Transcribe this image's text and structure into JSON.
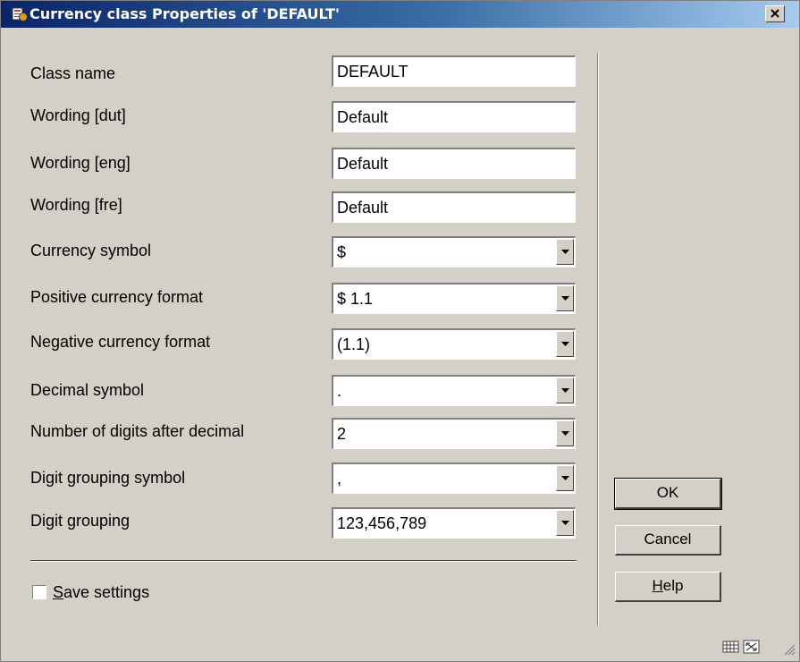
{
  "window": {
    "title": "Currency class Properties of 'DEFAULT'",
    "close_glyph": "×"
  },
  "fields": [
    {
      "label": "Class name",
      "value": "DEFAULT",
      "kind": "text"
    },
    {
      "label": "Wording [dut]",
      "value": "Default",
      "kind": "text"
    },
    {
      "label": "Wording [eng]",
      "value": "Default",
      "kind": "text"
    },
    {
      "label": "Wording [fre]",
      "value": "Default",
      "kind": "text"
    },
    {
      "label": "Currency symbol",
      "value": "$",
      "kind": "dropdown"
    },
    {
      "label": "Positive currency format",
      "value": "$ 1.1",
      "kind": "dropdown"
    },
    {
      "label": "Negative currency format",
      "value": "(1.1)",
      "kind": "dropdown"
    },
    {
      "label": "Decimal symbol",
      "value": ".",
      "kind": "dropdown"
    },
    {
      "label": "Number of digits after decimal",
      "value": "2",
      "kind": "dropdown"
    },
    {
      "label": "Digit grouping symbol",
      "value": ",",
      "kind": "dropdown"
    },
    {
      "label": "Digit grouping",
      "value": "123,456,789",
      "kind": "dropdown"
    }
  ],
  "save_settings": {
    "mnemonic": "S",
    "label_rest": "ave settings",
    "checked": false
  },
  "buttons": {
    "ok": "OK",
    "cancel": "Cancel",
    "help_mnemonic": "H",
    "help_rest": "elp"
  },
  "icons": {
    "title": "app-icon",
    "status_left": "grid-icon",
    "status_right": "resize-icon"
  }
}
